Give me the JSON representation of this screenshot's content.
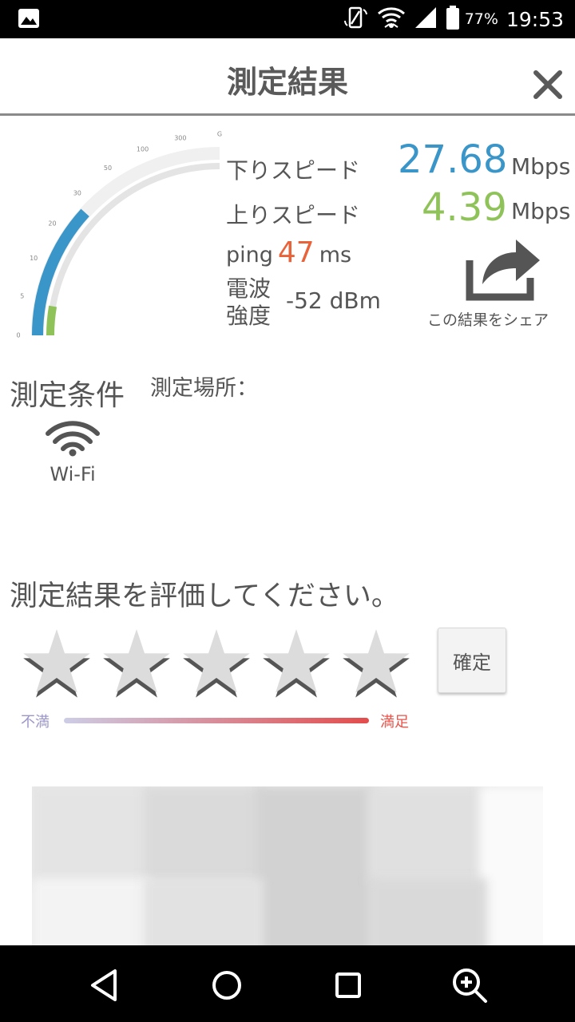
{
  "status_bar": {
    "battery_percent": "77%",
    "time": "19:53",
    "icons": [
      "image-icon",
      "rotate-icon",
      "wifi-icon",
      "cell-signal-icon",
      "battery-icon"
    ]
  },
  "header": {
    "title": "測定結果",
    "close_icon": "close-icon"
  },
  "gauge": {
    "ticks": [
      "0",
      "5",
      "10",
      "20",
      "30",
      "50",
      "100",
      "300",
      "G"
    ],
    "download_mbps": 27.68,
    "upload_mbps": 4.39,
    "colors": {
      "download": "#3a95c8",
      "upload": "#8fc35a",
      "track": "#f0f0f0"
    }
  },
  "results": {
    "download_label": "下りスピード",
    "download_value": "27.68",
    "download_unit": "Mbps",
    "upload_label": "上りスピード",
    "upload_value": "4.39",
    "upload_unit": "Mbps",
    "ping_label": "ping",
    "ping_value": "47",
    "ping_unit": "ms",
    "signal_label_line1": "電波",
    "signal_label_line2": "強度",
    "signal_value": "-52 dBm"
  },
  "share": {
    "label": "この結果をシェア",
    "icon": "share-icon"
  },
  "conditions": {
    "title": "測定条件",
    "place_label": "測定場所：",
    "network_label": "Wi-Fi",
    "network_icon": "wifi-icon"
  },
  "rating": {
    "prompt": "測定結果を評価してください。",
    "stars_total": 5,
    "stars_selected": 0,
    "confirm_label": "確定",
    "scale_low": "不満",
    "scale_high": "満足"
  },
  "nav": {
    "icons": [
      "back-icon",
      "home-icon",
      "recents-icon",
      "zoom-in-icon"
    ]
  }
}
